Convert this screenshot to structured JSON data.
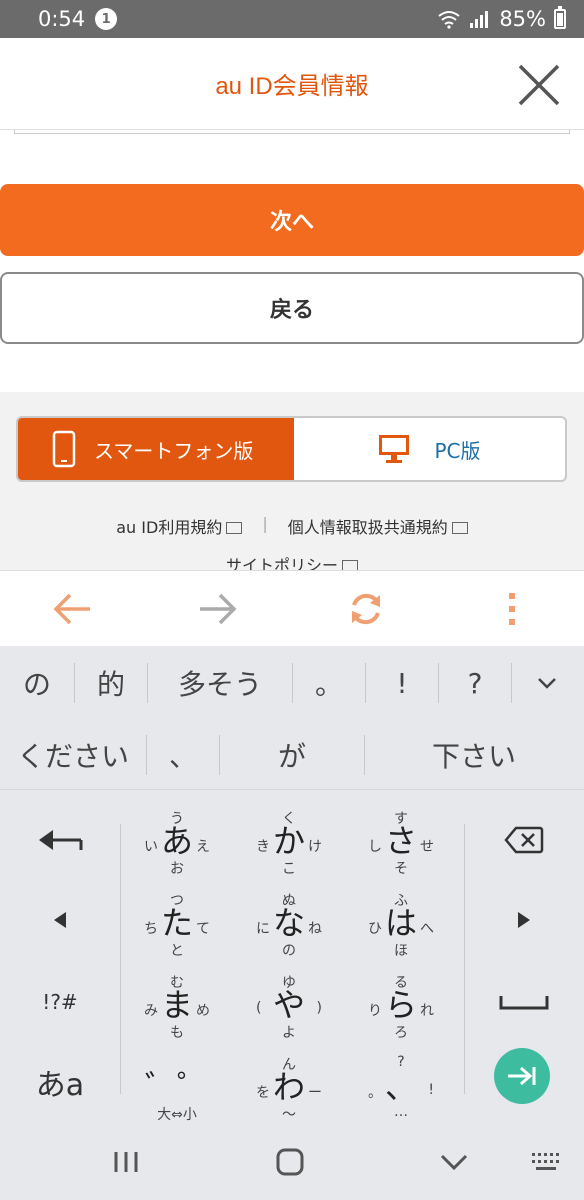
{
  "status_bar": {
    "time": "0:54",
    "notification_count": "1",
    "battery": "85%"
  },
  "header": {
    "title": "au ID会員情報",
    "close_icon": "close-icon"
  },
  "buttons": {
    "next": "次へ",
    "back": "戻る"
  },
  "view_toggle": {
    "smartphone": "スマートフォン版",
    "pc": "PC版"
  },
  "footer_links": {
    "terms": "au ID利用規約",
    "privacy_terms": "個人情報取扱共通規約",
    "site_policy": "サイトポリシー"
  },
  "browser_toolbar": {
    "back_icon": "arrow-left-icon",
    "forward_icon": "arrow-right-icon",
    "reload_icon": "reload-icon",
    "menu_icon": "more-vert-icon"
  },
  "keyboard": {
    "suggestions_row1": [
      "の",
      "的",
      "多そう",
      "。",
      "!",
      "?"
    ],
    "suggestions_row2": [
      "ください",
      "、",
      "が",
      "下さい"
    ],
    "keys": [
      {
        "main": "あ",
        "top": "う",
        "left": "い",
        "right": "え",
        "bottom": "お"
      },
      {
        "main": "か",
        "top": "く",
        "left": "き",
        "right": "け",
        "bottom": "こ"
      },
      {
        "main": "さ",
        "top": "す",
        "left": "し",
        "right": "せ",
        "bottom": "そ"
      },
      {
        "main": "た",
        "top": "つ",
        "left": "ち",
        "right": "て",
        "bottom": "と"
      },
      {
        "main": "な",
        "top": "ぬ",
        "left": "に",
        "right": "ね",
        "bottom": "の"
      },
      {
        "main": "は",
        "top": "ふ",
        "left": "ひ",
        "right": "へ",
        "bottom": "ほ"
      },
      {
        "main": "ま",
        "top": "む",
        "left": "み",
        "right": "め",
        "bottom": "も"
      },
      {
        "main": "や",
        "top": "ゆ",
        "left": "(",
        "right": ")",
        "bottom": "よ"
      },
      {
        "main": "ら",
        "top": "る",
        "left": "り",
        "right": "れ",
        "bottom": "ろ"
      },
      {
        "main": "゛゜",
        "top": "",
        "left": "",
        "right": "",
        "bottom": "大⇔小"
      },
      {
        "main": "わ",
        "top": "ん",
        "left": "を",
        "right": "ー",
        "bottom": "〜"
      },
      {
        "main": "、",
        "top": "?",
        "left": "。",
        "right": "!",
        "bottom": "…"
      }
    ],
    "side_left": [
      "backspace-left-icon",
      "cursor-left-icon",
      "!?#",
      "あa"
    ],
    "side_right": [
      "delete-icon",
      "cursor-right-icon",
      "space-icon",
      "enter-icon"
    ]
  },
  "nav_bar": {
    "recents": "recents-icon",
    "home": "home-icon",
    "back": "chevron-down-icon",
    "keyboard": "keyboard-icon"
  }
}
